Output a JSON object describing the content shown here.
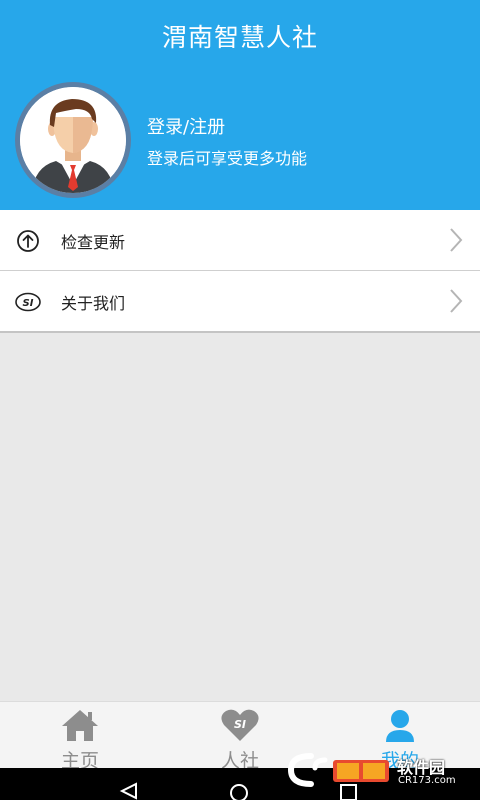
{
  "header": {
    "title": "渭南智慧人社",
    "login_link": "登录/注册",
    "login_hint": "登录后可享受更多功能"
  },
  "menu": {
    "items": [
      {
        "label": "检查更新",
        "icon": "upload-arrow-circle-icon"
      },
      {
        "label": "关于我们",
        "icon": "si-logo-icon"
      }
    ]
  },
  "tabbar": {
    "tabs": [
      {
        "label": "主页",
        "icon": "home-icon",
        "active": false
      },
      {
        "label": "人社",
        "icon": "heart-si-icon",
        "active": false
      },
      {
        "label": "我的",
        "icon": "user-icon",
        "active": true
      }
    ]
  },
  "watermark": {
    "text": "软件园",
    "sub": "CR173.com"
  },
  "colors": {
    "primary": "#27a7ea",
    "avatar_border": "#5b7fa5",
    "background": "#e9e9e9",
    "tab_inactive": "#8d8d8d"
  }
}
